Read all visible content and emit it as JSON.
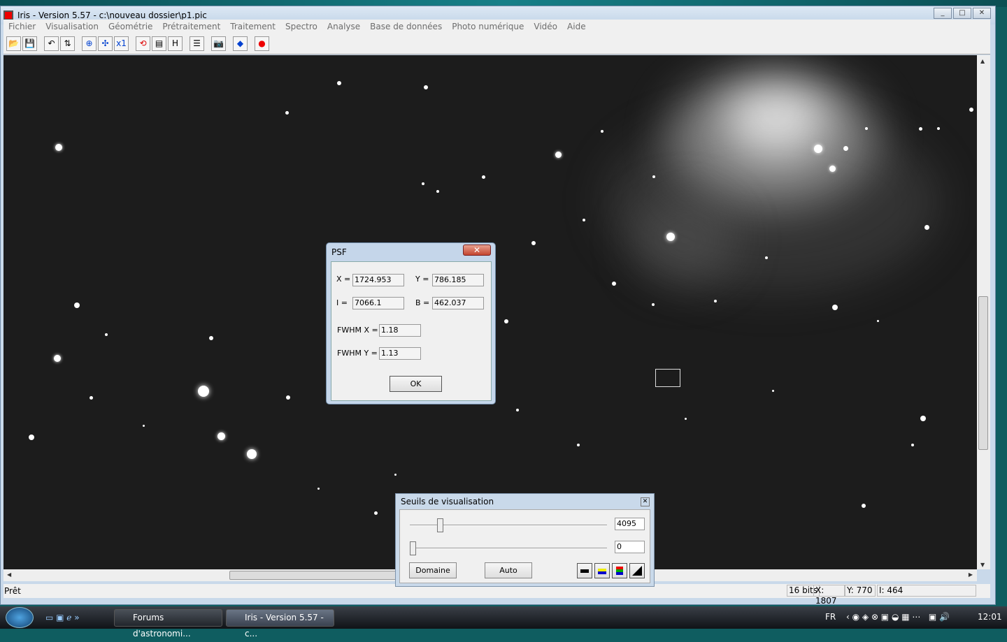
{
  "window": {
    "title": "Iris - Version 5.57 - c:\\nouveau dossier\\p1.pic",
    "controls": [
      "_",
      "□",
      "✕"
    ]
  },
  "menu": [
    "Fichier",
    "Visualisation",
    "Géométrie",
    "Prétraitement",
    "Traitement",
    "Spectro",
    "Analyse",
    "Base de données",
    "Photo numérique",
    "Vidéo",
    "Aide"
  ],
  "toolbar": [
    {
      "name": "open-icon",
      "glyph": "📂"
    },
    {
      "name": "save-icon",
      "glyph": "💾"
    },
    {
      "sep": true
    },
    {
      "name": "undo-icon",
      "glyph": "↶"
    },
    {
      "name": "threshold-icon",
      "glyph": "⇅"
    },
    {
      "sep": true
    },
    {
      "name": "zoom-in-icon",
      "glyph": "⊕"
    },
    {
      "name": "zoom-out-icon",
      "glyph": "✣"
    },
    {
      "name": "zoom-1x-icon",
      "glyph": "x1"
    },
    {
      "sep": true
    },
    {
      "name": "rotate-icon",
      "glyph": "⟲"
    },
    {
      "name": "palette-icon",
      "glyph": "▤"
    },
    {
      "name": "histogram-icon",
      "glyph": "H"
    },
    {
      "sep": true
    },
    {
      "name": "list-icon",
      "glyph": "☰"
    },
    {
      "sep": true
    },
    {
      "name": "camera-icon",
      "glyph": "📷"
    },
    {
      "sep": true
    },
    {
      "name": "diamond-icon",
      "glyph": "◆"
    },
    {
      "sep": true
    },
    {
      "name": "record-icon",
      "glyph": "●"
    }
  ],
  "status": {
    "ready": "Prêt",
    "bits": "16 bits",
    "x": "X: 1807",
    "y": "Y: 770",
    "i": "I: 464"
  },
  "psf": {
    "title": "PSF",
    "x_label": "X =",
    "x": "1724.953",
    "y_label": "Y =",
    "y": "786.185",
    "i_label": "I =",
    "i": "7066.1",
    "b_label": "B =",
    "b": "462.037",
    "fwhmx_label": "FWHM X =",
    "fwhmx": "1.18",
    "fwhmy_label": "FWHM Y =",
    "fwhmy": "1.13",
    "ok": "OK"
  },
  "seuils": {
    "title": "Seuils de visualisation",
    "high": "4095",
    "low": "0",
    "high_level": 0.14,
    "low_level": 0.0,
    "domaine": "Domaine",
    "auto": "Auto"
  },
  "taskbar": {
    "tasks": [
      "Forums d'astronomi...",
      "Iris - Version 5.57 - c..."
    ],
    "lang": "FR",
    "time": "12:01"
  }
}
